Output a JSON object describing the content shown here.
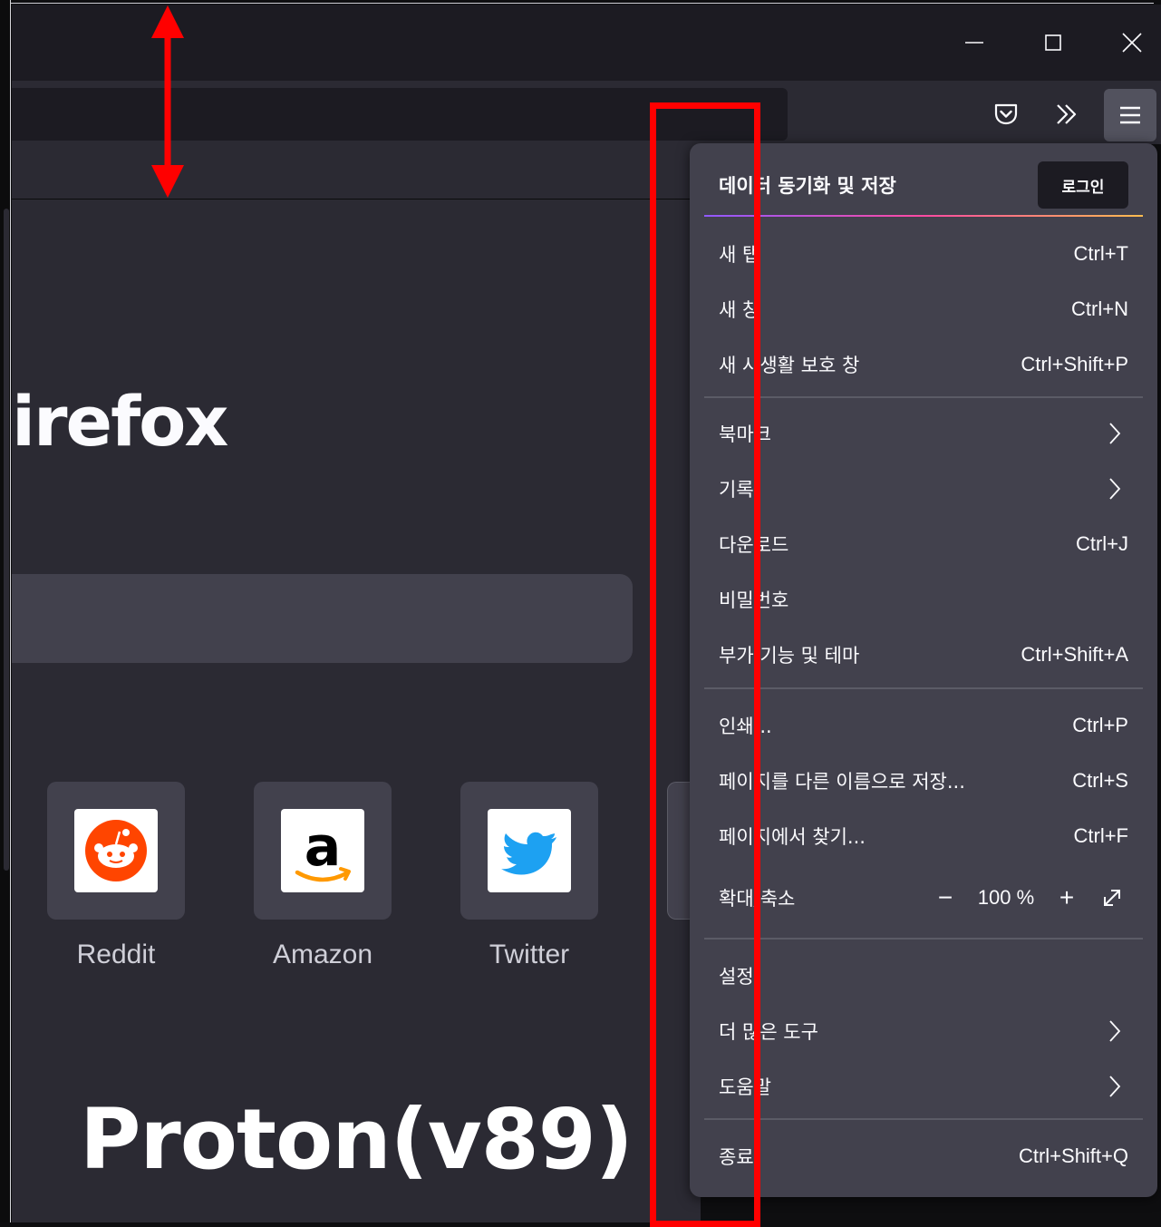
{
  "window": {
    "minimize_icon": "minimize-icon",
    "maximize_icon": "maximize-icon",
    "close_icon": "close-icon"
  },
  "toolbar": {
    "pocket_icon": "pocket-icon",
    "overflow_icon": "chevron-double-right-icon",
    "menu_icon": "hamburger-menu-icon"
  },
  "content": {
    "brand_text": "Firefox",
    "visible_brand_text": "irefox",
    "top_sites": [
      {
        "label": "Reddit",
        "icon": "reddit-icon",
        "color": "#ff4500"
      },
      {
        "label": "Amazon",
        "icon": "amazon-icon",
        "color": "#000000"
      },
      {
        "label": "Twitter",
        "icon": "twitter-icon",
        "color": "#1da1f2"
      }
    ]
  },
  "overlay": {
    "title": "Proton(v89)"
  },
  "menu": {
    "sync_title": "데이터 동기화 및 저장",
    "login_label": "로그인",
    "groups": [
      [
        {
          "label": "새 탭",
          "shortcut": "Ctrl+T"
        },
        {
          "label": "새 창",
          "shortcut": "Ctrl+N"
        },
        {
          "label": "새 사생활 보호 창",
          "shortcut": "Ctrl+Shift+P"
        }
      ],
      [
        {
          "label": "북마크",
          "submenu": true
        },
        {
          "label": "기록",
          "submenu": true
        },
        {
          "label": "다운로드",
          "shortcut": "Ctrl+J"
        },
        {
          "label": "비밀번호",
          "shortcut": ""
        },
        {
          "label": "부가 기능 및 테마",
          "shortcut": "Ctrl+Shift+A"
        }
      ],
      [
        {
          "label": "인쇄...",
          "shortcut": "Ctrl+P"
        },
        {
          "label": "페이지를 다른 이름으로 저장...",
          "shortcut": "Ctrl+S"
        },
        {
          "label": "페이지에서 찾기...",
          "shortcut": "Ctrl+F"
        }
      ],
      [
        {
          "label": "설정",
          "shortcut": ""
        },
        {
          "label": "더 많은 도구",
          "submenu": true
        },
        {
          "label": "도움말",
          "submenu": true
        }
      ],
      [
        {
          "label": "종료",
          "shortcut": "Ctrl+Shift+Q"
        }
      ]
    ],
    "zoom": {
      "label": "확대/축소",
      "minus": "−",
      "value": "100 %",
      "plus": "+",
      "fullscreen_icon": "fullscreen-icon"
    }
  },
  "annotation_colors": {
    "highlight": "#ff0000"
  }
}
